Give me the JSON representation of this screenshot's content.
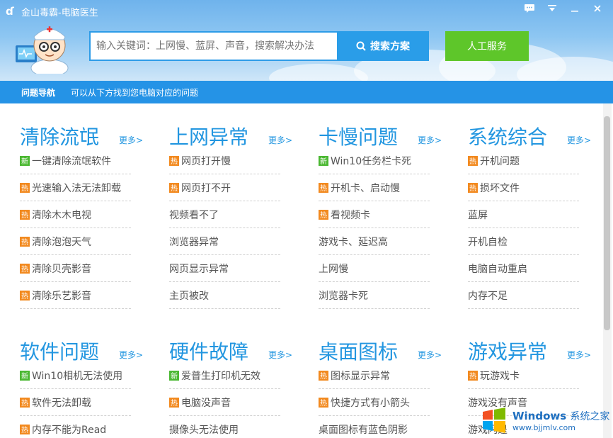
{
  "app": {
    "title": "金山毒霸-电脑医生"
  },
  "search": {
    "placeholder": "输入关键词：上网慢、蓝屏、声音，搜索解决办法",
    "button_label": "搜索方案"
  },
  "human_service_label": "人工服务",
  "nav": {
    "label": "问题导航",
    "description": "可以从下方找到您电脑对应的问题"
  },
  "more_label": "更多>",
  "badges": {
    "hot": "热",
    "new": "新"
  },
  "colors": {
    "accent": "#2296e0",
    "hot": "#f28a20",
    "new": "#4bb832",
    "service": "#5ec62a"
  },
  "sections": [
    {
      "title": "清除流氓",
      "items": [
        {
          "text": "一键清除流氓软件",
          "badge": "new"
        },
        {
          "text": "光速输入法无法卸载",
          "badge": "hot"
        },
        {
          "text": "清除木木电视",
          "badge": "hot"
        },
        {
          "text": "清除泡泡天气",
          "badge": "hot"
        },
        {
          "text": "清除贝壳影音",
          "badge": "hot"
        },
        {
          "text": "清除乐艺影音",
          "badge": "hot"
        }
      ]
    },
    {
      "title": "上网异常",
      "items": [
        {
          "text": "网页打开慢",
          "badge": "hot"
        },
        {
          "text": "网页打不开",
          "badge": "hot"
        },
        {
          "text": "视频看不了",
          "badge": ""
        },
        {
          "text": "浏览器异常",
          "badge": ""
        },
        {
          "text": "网页显示异常",
          "badge": ""
        },
        {
          "text": "主页被改",
          "badge": ""
        }
      ]
    },
    {
      "title": "卡慢问题",
      "items": [
        {
          "text": "Win10任务栏卡死",
          "badge": "new"
        },
        {
          "text": "开机卡、启动慢",
          "badge": "hot"
        },
        {
          "text": "看视频卡",
          "badge": "hot"
        },
        {
          "text": "游戏卡、延迟高",
          "badge": ""
        },
        {
          "text": "上网慢",
          "badge": ""
        },
        {
          "text": "浏览器卡死",
          "badge": ""
        }
      ]
    },
    {
      "title": "系统综合",
      "items": [
        {
          "text": "开机问题",
          "badge": "hot"
        },
        {
          "text": "损坏文件",
          "badge": "hot"
        },
        {
          "text": "蓝屏",
          "badge": ""
        },
        {
          "text": "开机自检",
          "badge": ""
        },
        {
          "text": "电脑自动重启",
          "badge": ""
        },
        {
          "text": "内存不足",
          "badge": ""
        }
      ]
    },
    {
      "title": "软件问题",
      "items": [
        {
          "text": "Win10相机无法使用",
          "badge": "new"
        },
        {
          "text": "软件无法卸载",
          "badge": "hot"
        },
        {
          "text": "内存不能为Read",
          "badge": "hot"
        }
      ]
    },
    {
      "title": "硬件故障",
      "items": [
        {
          "text": "爱普生打印机无效",
          "badge": "new"
        },
        {
          "text": "电脑没声音",
          "badge": "hot"
        },
        {
          "text": "摄像头无法使用",
          "badge": ""
        }
      ]
    },
    {
      "title": "桌面图标",
      "items": [
        {
          "text": "图标显示异常",
          "badge": "hot"
        },
        {
          "text": "快捷方式有小箭头",
          "badge": "hot"
        },
        {
          "text": "桌面图标有蓝色阴影",
          "badge": ""
        }
      ]
    },
    {
      "title": "游戏异常",
      "items": [
        {
          "text": "玩游戏卡",
          "badge": "hot"
        },
        {
          "text": "游戏没有声音",
          "badge": ""
        },
        {
          "text": "游戏闪退",
          "badge": ""
        }
      ]
    }
  ],
  "watermark": {
    "brand": "Windows",
    "brand_cn": "系统之家",
    "url": "www.bjjmlv.com"
  }
}
